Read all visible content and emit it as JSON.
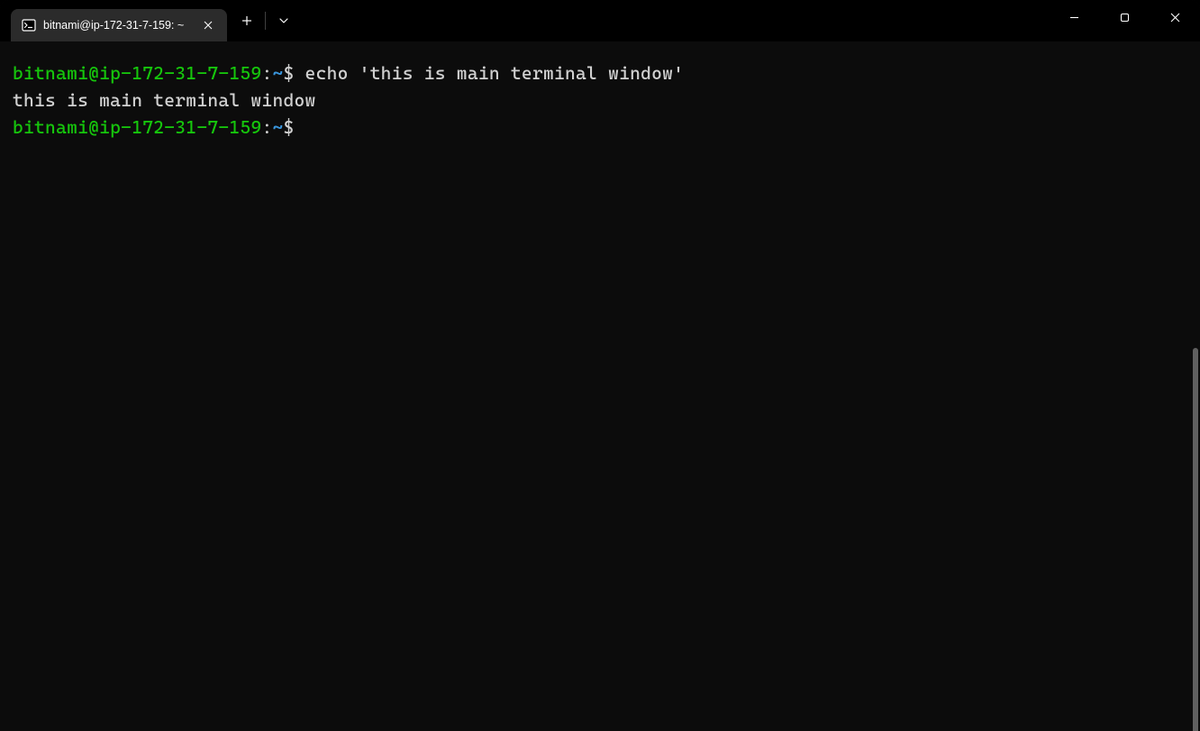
{
  "tab": {
    "title": "bitnami@ip-172-31-7-159: ~"
  },
  "terminal": {
    "lines": [
      {
        "user_host": "bitnami@ip-172-31-7-159",
        "colon": ":",
        "path": "~",
        "dollar": "$ ",
        "command": "echo 'this is main terminal window'"
      }
    ],
    "output1": "this is main terminal window",
    "prompt2": {
      "user_host": "bitnami@ip-172-31-7-159",
      "colon": ":",
      "path": "~",
      "dollar": "$ "
    }
  },
  "colors": {
    "prompt_user": "#16c60c",
    "prompt_path": "#3a96dd",
    "text": "#d1d1d1",
    "background": "#0c0c0c",
    "tab_bg": "#2b2b2b"
  }
}
